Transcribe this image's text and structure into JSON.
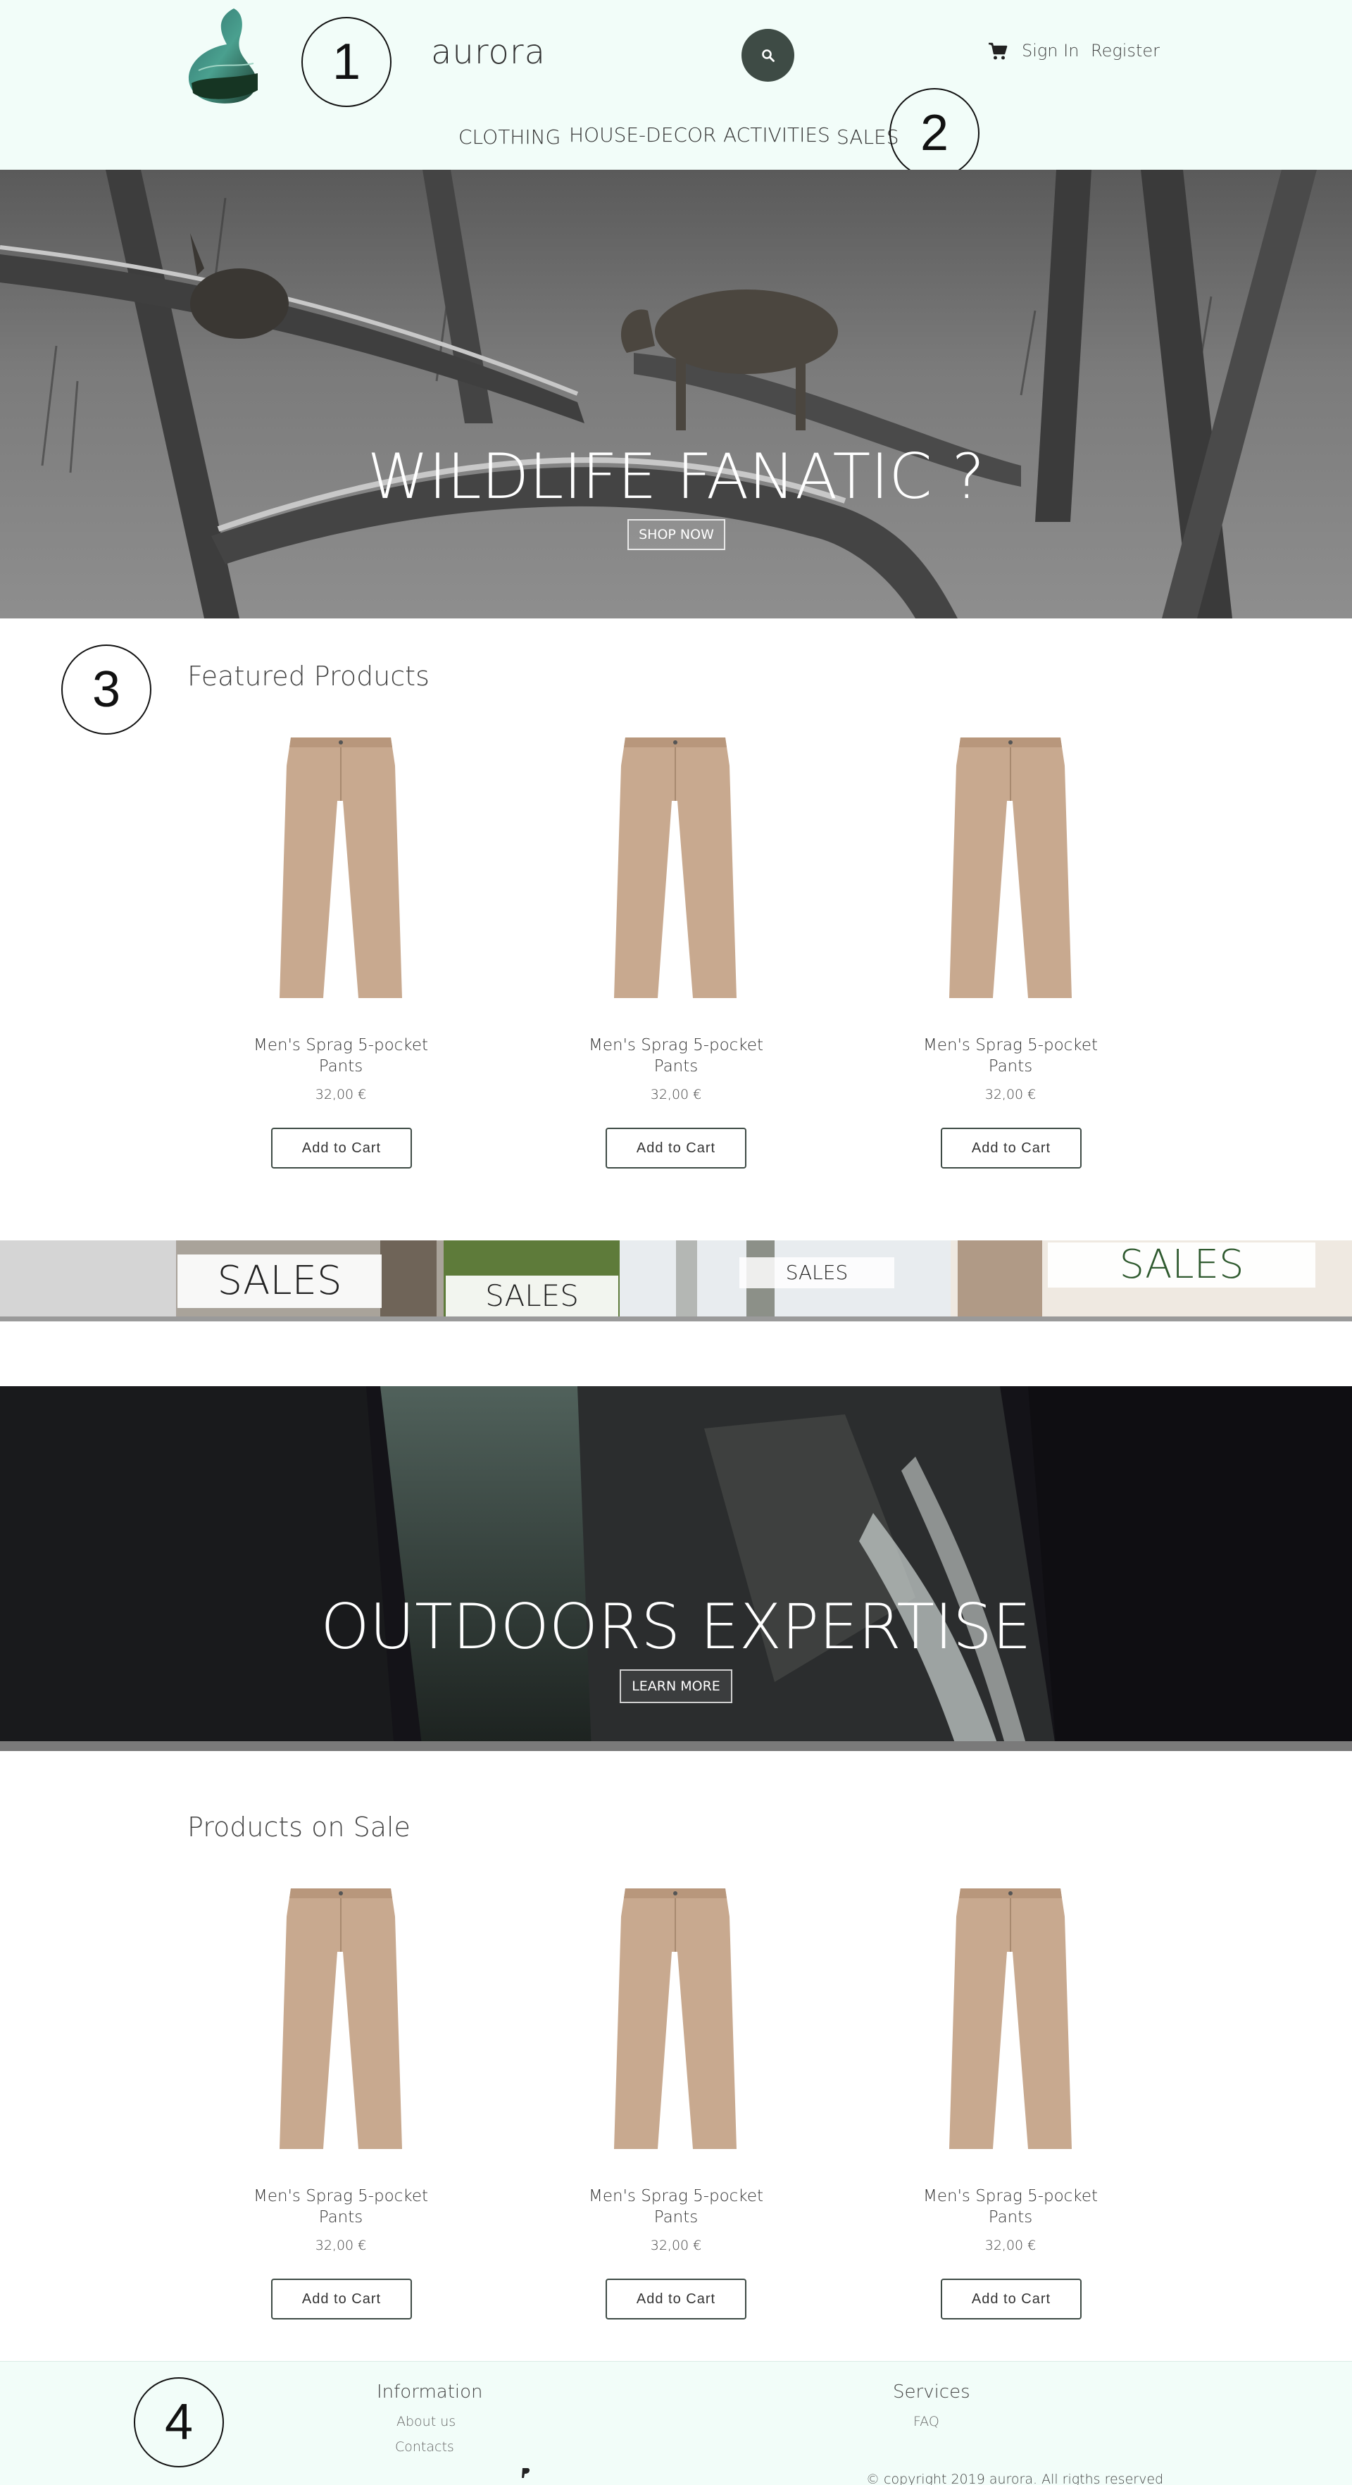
{
  "header": {
    "brand": "aurora",
    "search_icon": "search-icon",
    "cart_icon": "shopping-cart-icon",
    "sign_in": "Sign In",
    "register": "Register",
    "nav": [
      "CLOTHING",
      "HOUSE-DECOR",
      "ACTIVITIES",
      "SALES"
    ]
  },
  "markers": [
    "1",
    "2",
    "3",
    "4"
  ],
  "hero1": {
    "title": "WILDLIFE FANATIC ?",
    "button": "SHOP NOW"
  },
  "featured": {
    "title": "Featured Products",
    "products": [
      {
        "name_line1": "Men's Sprag 5-pocket",
        "name_line2": "Pants",
        "price": "32,00 €",
        "button": "Add to Cart"
      },
      {
        "name_line1": "Men's Sprag 5-pocket",
        "name_line2": "Pants",
        "price": "32,00 €",
        "button": "Add to Cart"
      },
      {
        "name_line1": "Men's Sprag 5-pocket",
        "name_line2": "Pants",
        "price": "32,00 €",
        "button": "Add to Cart"
      }
    ]
  },
  "sales_banner": {
    "labels": [
      "SALES",
      "SALES",
      "SALES",
      "SALES"
    ],
    "accent_color": "#2f5a2f"
  },
  "hero2": {
    "title": "OUTDOORS EXPERTISE",
    "button": "LEARN MORE"
  },
  "on_sale": {
    "title": "Products on Sale",
    "products": [
      {
        "name_line1": "Men's Sprag 5-pocket",
        "name_line2": "Pants",
        "price": "32,00 €",
        "button": "Add to Cart"
      },
      {
        "name_line1": "Men's Sprag 5-pocket",
        "name_line2": "Pants",
        "price": "32,00 €",
        "button": "Add to Cart"
      },
      {
        "name_line1": "Men's Sprag 5-pocket",
        "name_line2": "Pants",
        "price": "32,00 €",
        "button": "Add to Cart"
      }
    ]
  },
  "footer": {
    "information": {
      "heading": "Information",
      "links": [
        "About us",
        "Contacts"
      ]
    },
    "services": {
      "heading": "Services",
      "links": [
        "FAQ"
      ]
    },
    "payment_icon": "paypal-icon",
    "copyright": "© copyright 2019 aurora. All rigths reserved"
  },
  "colors": {
    "header_bg": "#f2fdf9",
    "button_dark": "#3e4b45",
    "product_tan": "#c8a98f"
  }
}
